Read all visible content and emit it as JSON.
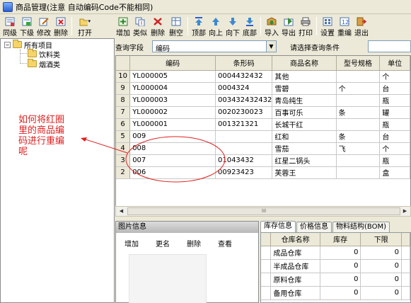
{
  "window": {
    "title": "商品管理(注意 自动编码Code不能相同)"
  },
  "toolbar_left": [
    {
      "label": "同级",
      "icon": "add-sibling-icon"
    },
    {
      "label": "下级",
      "icon": "add-child-icon"
    },
    {
      "label": "修改",
      "icon": "edit-icon"
    },
    {
      "label": "删除",
      "icon": "delete-icon"
    },
    {
      "label": "打开",
      "icon": "open-folder-icon"
    }
  ],
  "toolbar_main": [
    {
      "label": "增加",
      "icon": "add-icon"
    },
    {
      "label": "类似",
      "icon": "copy-icon"
    },
    {
      "label": "删除",
      "icon": "delete-icon"
    },
    {
      "label": "删空",
      "icon": "clear-icon"
    },
    {
      "label": "顶部",
      "icon": "top-icon"
    },
    {
      "label": "向上",
      "icon": "up-icon"
    },
    {
      "label": "向下",
      "icon": "down-icon"
    },
    {
      "label": "底部",
      "icon": "bottom-icon"
    },
    {
      "label": "导入",
      "icon": "import-icon"
    },
    {
      "label": "导出",
      "icon": "export-icon"
    },
    {
      "label": "打印",
      "icon": "print-icon"
    },
    {
      "label": "设置",
      "icon": "settings-icon"
    },
    {
      "label": "重编",
      "icon": "renumber-icon"
    },
    {
      "label": "退出",
      "icon": "exit-icon"
    }
  ],
  "tree": {
    "root": "所有项目",
    "children": [
      "饮料类",
      "烟酒类"
    ]
  },
  "query": {
    "field_label": "查询字段",
    "field_value": "编码",
    "condition_label": "请选择查询条件",
    "condition_value": ""
  },
  "grid": {
    "columns": [
      "编码",
      "条形码",
      "商品名称",
      "型号规格",
      "单位"
    ],
    "rows": [
      {
        "n": "10",
        "code": "YL000005",
        "barcode": "0004432432",
        "name": "其他",
        "spec": "",
        "unit": "个"
      },
      {
        "n": "9",
        "code": "YL000004",
        "barcode": "0004324",
        "name": "雪碧",
        "spec": "个",
        "unit": "台"
      },
      {
        "n": "8",
        "code": "YL000003",
        "barcode": "003432432432",
        "name": "青岛纯生",
        "spec": "",
        "unit": "瓶"
      },
      {
        "n": "7",
        "code": "YL000002",
        "barcode": "0020230023",
        "name": "百事可乐",
        "spec": "条",
        "unit": "罐"
      },
      {
        "n": "6",
        "code": "YL000001",
        "barcode": "001321321",
        "name": "长城干红",
        "spec": "",
        "unit": "瓶"
      },
      {
        "n": "5",
        "code": "009",
        "barcode": "",
        "name": "红和",
        "spec": "条",
        "unit": "台"
      },
      {
        "n": "4",
        "code": "008",
        "barcode": "",
        "name": "雪茄",
        "spec": "飞",
        "unit": "个"
      },
      {
        "n": "3",
        "code": "007",
        "barcode": "01043432",
        "name": "红星二锅头",
        "spec": "",
        "unit": "瓶"
      },
      {
        "n": "2",
        "code": "006",
        "barcode": "00923423",
        "name": "芙蓉王",
        "spec": "",
        "unit": "盒"
      }
    ],
    "scroll_thumb": "III"
  },
  "image_panel": {
    "title": "图片信息",
    "buttons": [
      "增加",
      "更名",
      "删除",
      "查看"
    ]
  },
  "tabs": [
    "库存信息",
    "价格信息",
    "物料结构(BOM)"
  ],
  "stock": {
    "columns": [
      "仓库名称",
      "库存",
      "下限"
    ],
    "rows": [
      {
        "name": "成品仓库",
        "qty": "0",
        "min": "0"
      },
      {
        "name": "半成品仓库",
        "qty": "0",
        "min": "0"
      },
      {
        "name": "原料仓库",
        "qty": "0",
        "min": "0"
      },
      {
        "name": "备用仓库",
        "qty": "0",
        "min": "0"
      }
    ]
  },
  "annotation": {
    "text": "如何将红圈里的商品编码进行重编呢",
    "color": "#e02020"
  }
}
